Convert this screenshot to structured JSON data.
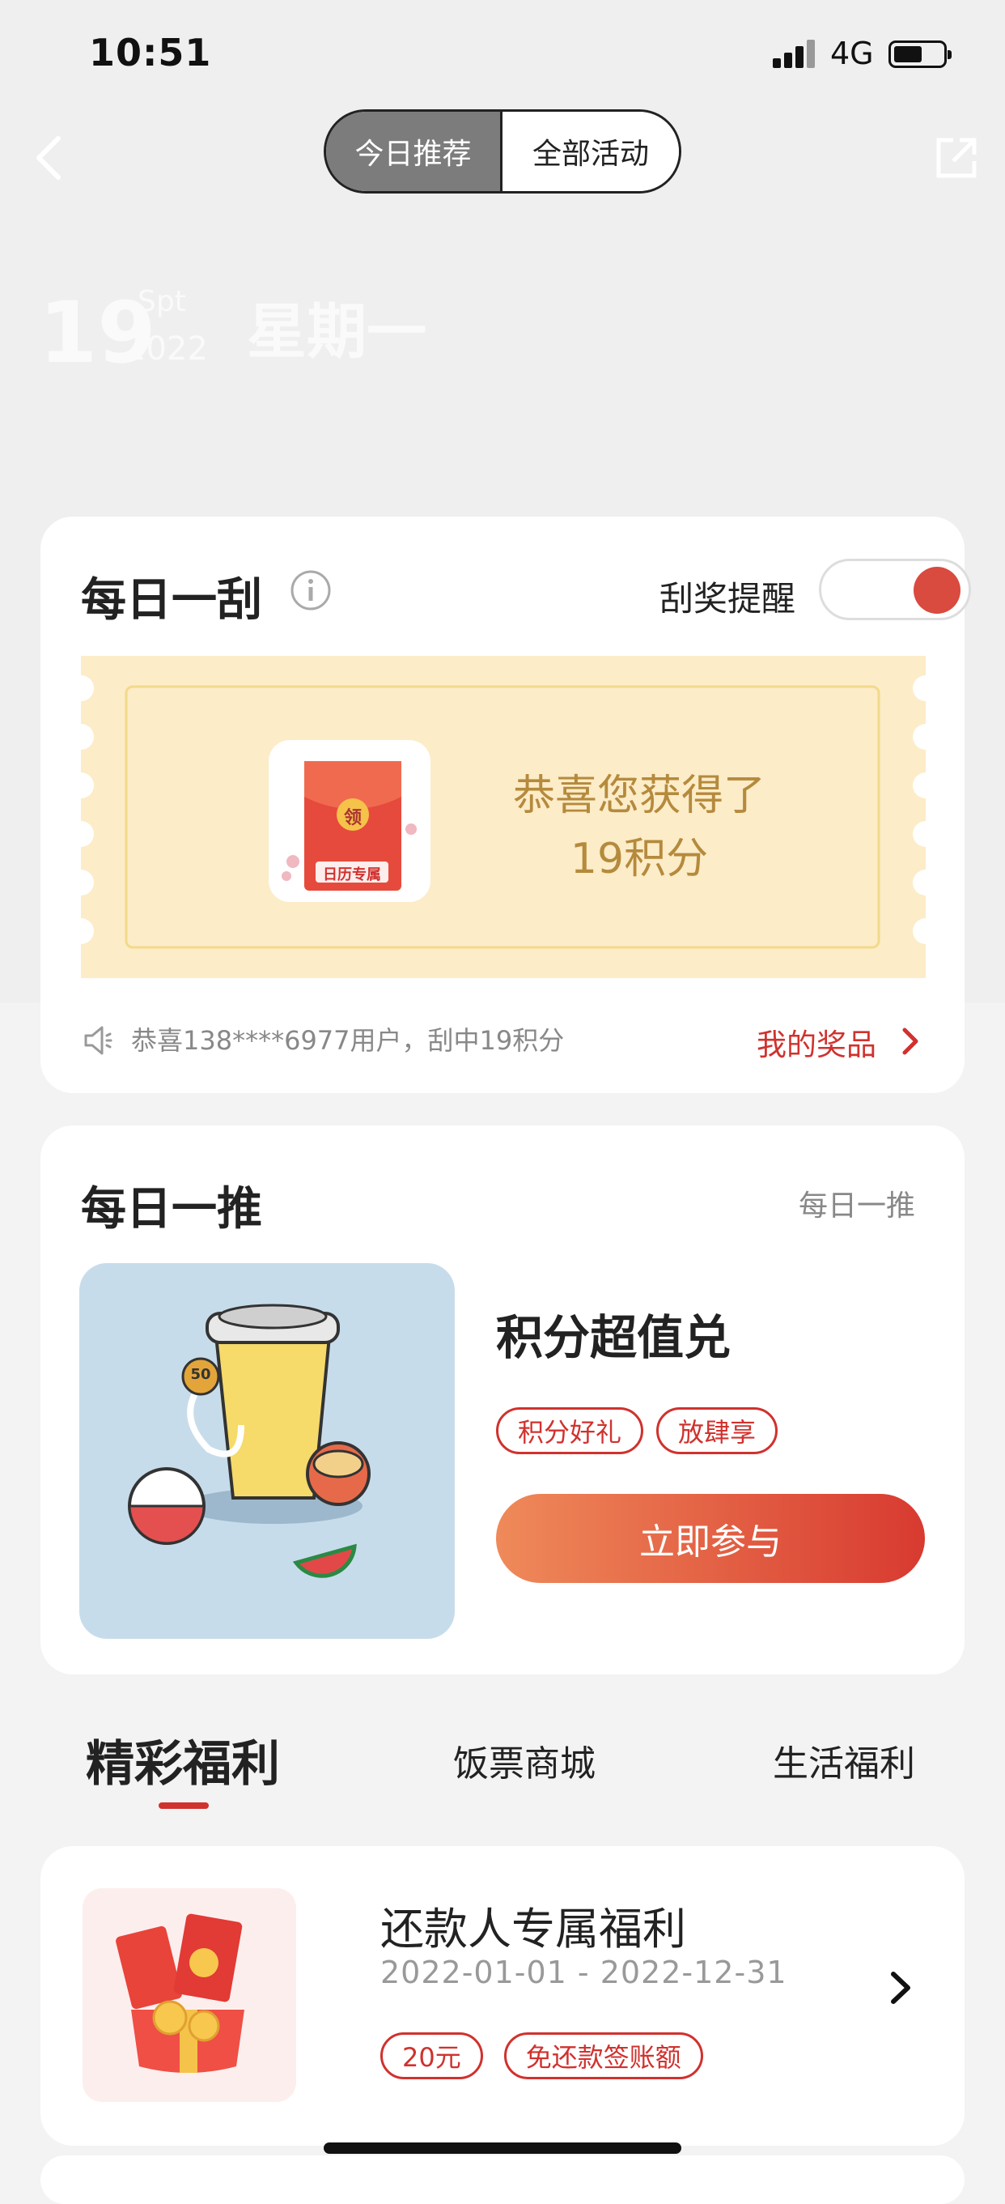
{
  "status_bar": {
    "time": "10:51",
    "network": "4G"
  },
  "nav": {
    "segment_today": "今日推荐",
    "segment_all": "全部活动"
  },
  "date": {
    "day": "19",
    "month": "Spt",
    "year": "2022",
    "weekday": "星期一"
  },
  "scratch_card": {
    "title": "每日一刮",
    "remind_label": "刮奖提醒",
    "remind_on": true,
    "prize_line1": "恭喜您获得了",
    "prize_line2": "19积分",
    "prize_badge": "领",
    "prize_caption": "日历专属",
    "ticker": "恭喜138****6977用户，刮中19积分",
    "my_prizes": "我的奖品"
  },
  "daily_push": {
    "title": "每日一推",
    "more": "每日一推",
    "item_title": "积分超值兑",
    "tags": [
      "积分好礼",
      "放肆享"
    ],
    "button": "立即参与",
    "cup_badge": "50"
  },
  "tabs": [
    "精彩福利",
    "饭票商城",
    "生活福利"
  ],
  "welfare_item": {
    "title": "还款人专属福利",
    "date_range": "2022-01-01 - 2022-12-31",
    "tags": [
      "20元",
      "免还款签账额"
    ]
  },
  "colors": {
    "accent": "#d0322e",
    "gold": "#b58a3c",
    "ticket": "#fcecc8"
  }
}
